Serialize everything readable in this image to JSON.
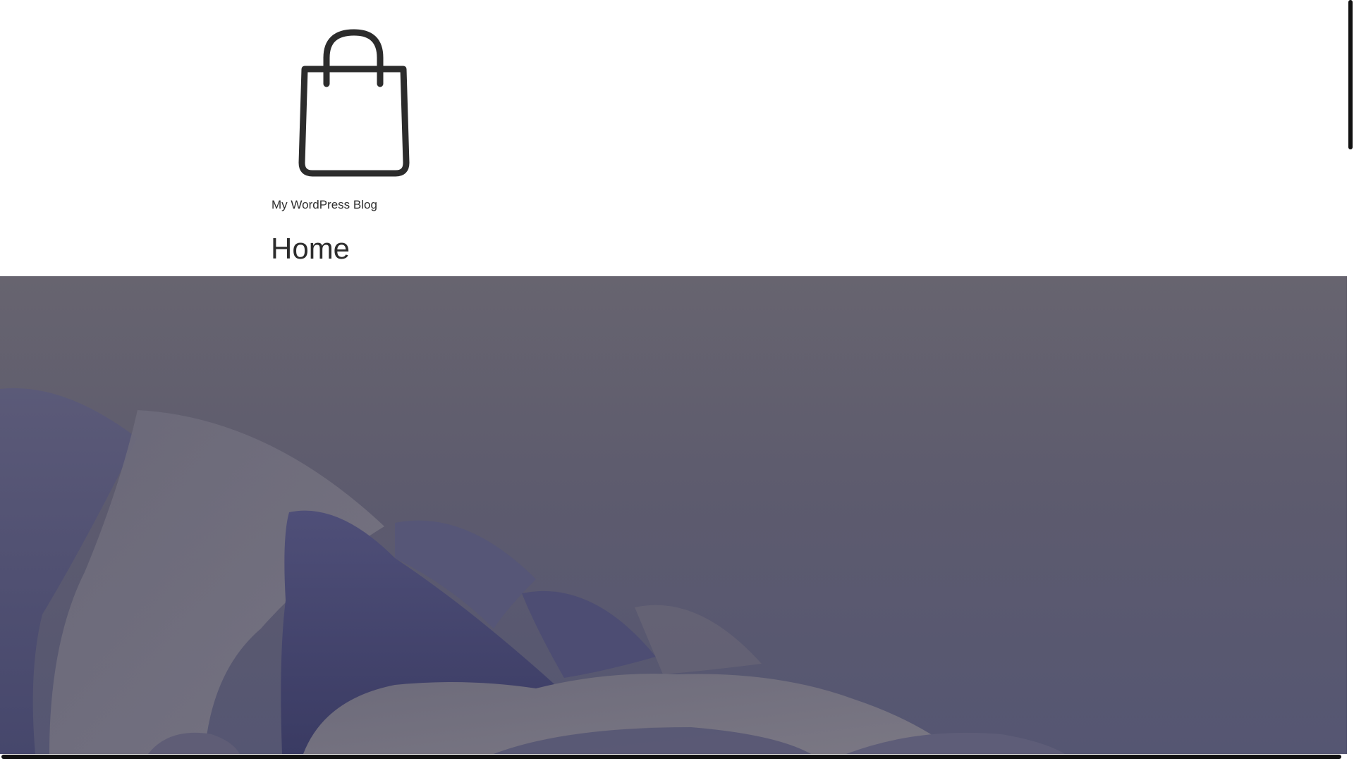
{
  "site": {
    "logo_icon": "shopping-bag-icon",
    "title": "My WordPress Blog"
  },
  "page": {
    "title": "Home"
  },
  "hero": {
    "image": "abstract-purple-petals",
    "colors": {
      "top": "#67646f",
      "bottom": "#555672",
      "petal_dark": "#3e3f68",
      "petal_light": "#75727f"
    }
  }
}
